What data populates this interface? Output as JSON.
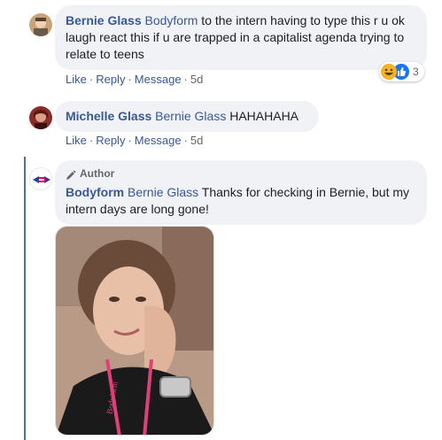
{
  "comments": [
    {
      "author": "Bernie Glass",
      "mention": "Bodyform",
      "text": " to the intern having to type this r u ok laugh react this if u are trapped in a capitalist agenda trying to relate to teens",
      "actions": {
        "like": "Like",
        "reply": "Reply",
        "message": "Message",
        "time": "5d"
      },
      "reactions": {
        "icons": [
          "haha-icon",
          "like-icon"
        ],
        "count": "3"
      }
    },
    {
      "author": "Michelle Glass",
      "mention": "Bernie Glass",
      "text": " HAHAHAHA",
      "actions": {
        "like": "Like",
        "reply": "Reply",
        "message": "Message",
        "time": "5d"
      }
    },
    {
      "badge": "Author",
      "author": "Bodyform",
      "mention": "Bernie Glass",
      "text": " Thanks for checking in Bernie, but my intern days are long gone!"
    }
  ],
  "photo": {
    "lanyard_text": "Bodyform"
  },
  "colors": {
    "link": "#385898",
    "bubble": "#f0f2f5",
    "meta": "#65676b",
    "reply_bar": "#4a6ebf"
  }
}
